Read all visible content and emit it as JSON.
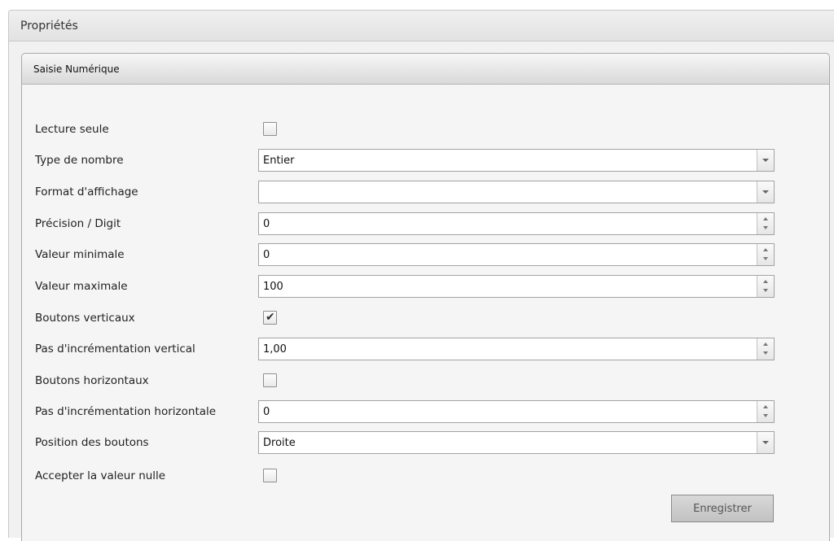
{
  "panel": {
    "title": "Propriétés"
  },
  "section": {
    "title": "Saisie Numérique"
  },
  "rows": [
    {
      "label": "Lecture seule",
      "type": "checkbox",
      "checked": false
    },
    {
      "label": "Type de nombre",
      "type": "select",
      "value": "Entier"
    },
    {
      "label": "Format d'affichage",
      "type": "select",
      "value": ""
    },
    {
      "label": "Précision / Digit",
      "type": "spinner",
      "value": "0"
    },
    {
      "label": "Valeur minimale",
      "type": "spinner",
      "value": "0"
    },
    {
      "label": "Valeur maximale",
      "type": "spinner",
      "value": "100"
    },
    {
      "label": "Boutons verticaux",
      "type": "checkbox",
      "checked": true
    },
    {
      "label": "Pas d'incrémentation vertical",
      "type": "spinner",
      "value": "1,00"
    },
    {
      "label": "Boutons horizontaux",
      "type": "checkbox",
      "checked": false
    },
    {
      "label": "Pas d'incrémentation horizontale",
      "type": "spinner",
      "value": "0"
    },
    {
      "label": "Position des boutons",
      "type": "select",
      "value": "Droite"
    },
    {
      "label": "Accepter la valeur nulle",
      "type": "checkbox",
      "checked": false
    }
  ],
  "actions": {
    "save_label": "Enregistrer"
  },
  "icons": {
    "checkmark": "✔",
    "dropdown": "chevron-down-icon",
    "spinner": "spinner-arrows-icon"
  }
}
